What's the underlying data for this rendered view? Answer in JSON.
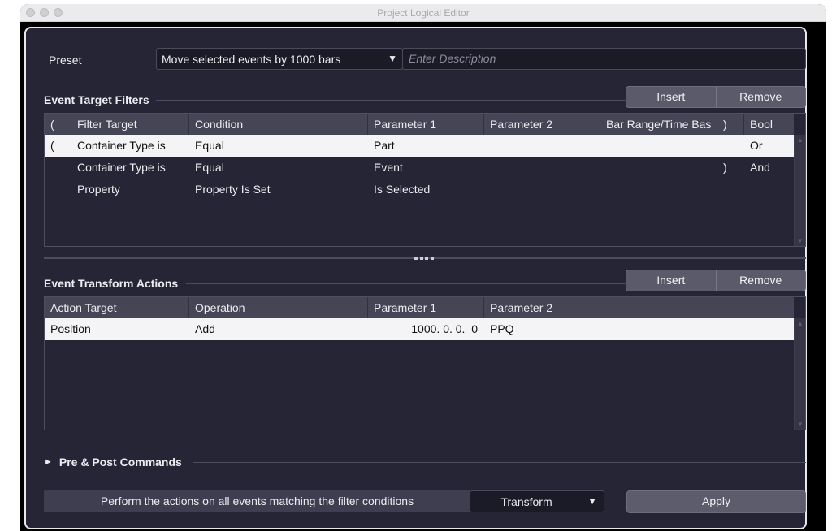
{
  "window": {
    "title": "Project Logical Editor"
  },
  "preset": {
    "label": "Preset",
    "selected": "Move selected events by 1000 bars",
    "arrow": "▼",
    "description_placeholder": "Enter Description"
  },
  "filters": {
    "title": "Event Target Filters",
    "insert_label": "Insert",
    "remove_label": "Remove",
    "columns": [
      "(",
      "Filter Target",
      "Condition",
      "Parameter 1",
      "Parameter 2",
      "Bar Range/Time Bas",
      ")",
      "Bool"
    ],
    "rows": [
      {
        "open": "(",
        "target": "Container Type is",
        "condition": "Equal",
        "param1": "Part",
        "param2": "",
        "range": "",
        "close": "",
        "bool": "Or",
        "selected": true
      },
      {
        "open": "",
        "target": "Container Type is",
        "condition": "Equal",
        "param1": "Event",
        "param2": "",
        "range": "",
        "close": ")",
        "bool": "And",
        "selected": false
      },
      {
        "open": "",
        "target": "Property",
        "condition": "Property Is Set",
        "param1": "Is Selected",
        "param2": "",
        "range": "",
        "close": "",
        "bool": "",
        "selected": false
      }
    ]
  },
  "actions": {
    "title": "Event Transform Actions",
    "insert_label": "Insert",
    "remove_label": "Remove",
    "columns": [
      "Action Target",
      "Operation",
      "Parameter 1",
      "Parameter 2"
    ],
    "rows": [
      {
        "target": "Position",
        "operation": "Add",
        "param1": "1000. 0. 0.  0",
        "param2": "PPQ",
        "selected": true
      }
    ]
  },
  "pre_post": {
    "arrow": "►",
    "title": "Pre & Post Commands"
  },
  "footer": {
    "perform_text": "Perform the actions on all events matching the filter conditions",
    "function_selected": "Transform",
    "function_arrow": "▼",
    "apply_label": "Apply"
  }
}
